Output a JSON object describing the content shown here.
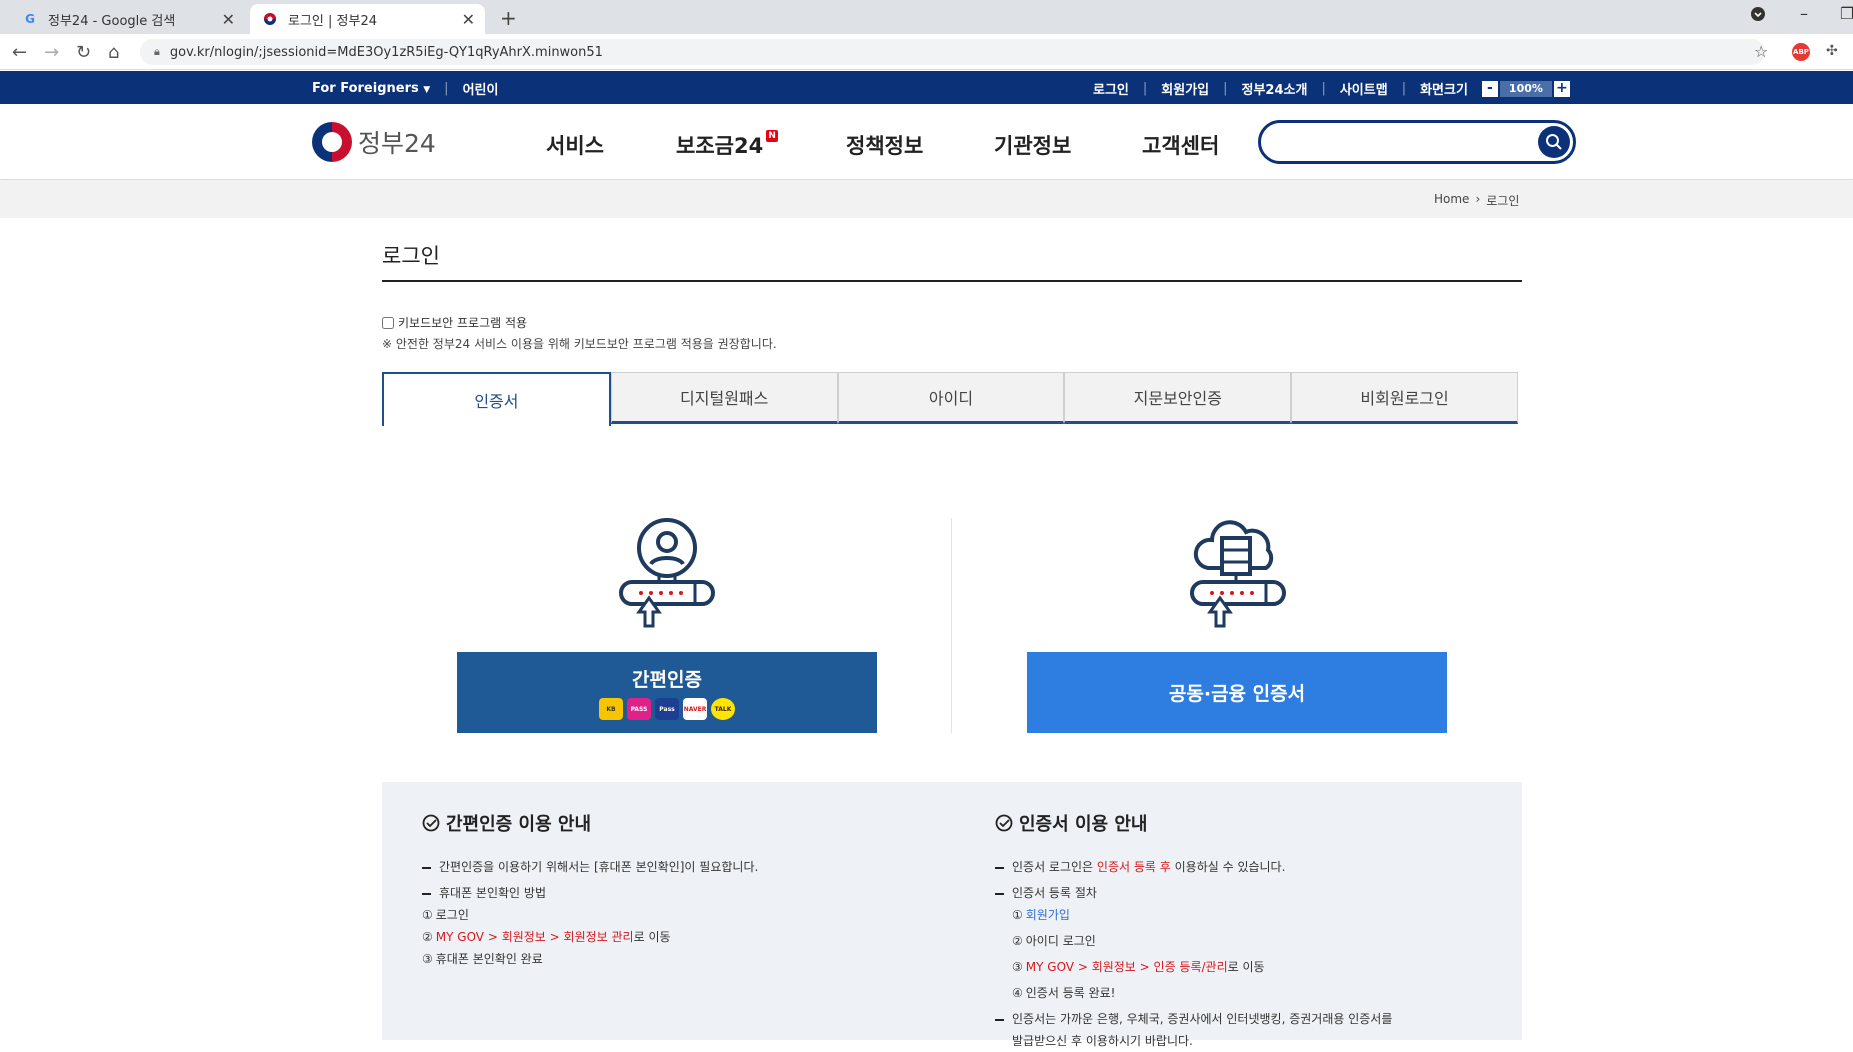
{
  "browser": {
    "tabs": [
      {
        "title": "정부24 - Google 검색",
        "active": false
      },
      {
        "title": "로그인 | 정부24",
        "active": true
      }
    ],
    "url": "gov.kr/nlogin/;jsessionid=MdE3Oy1zR5iEg-QY1qRyAhrX.minwon51"
  },
  "utilbar": {
    "left": [
      "For Foreigners",
      "어린이"
    ],
    "right": [
      "로그인",
      "회원가입",
      "정부24소개",
      "사이트맵"
    ],
    "zoom_label": "화면크기",
    "zoom_value": "100%",
    "zoom_minus": "-",
    "zoom_plus": "+"
  },
  "header": {
    "logo_text": "정부24",
    "nav": [
      "서비스",
      "보조금24",
      "정책정보",
      "기관정보",
      "고객센터"
    ],
    "new_badge": "N",
    "search_placeholder": ""
  },
  "breadcrumb": [
    "Home",
    "로그인"
  ],
  "page": {
    "title": "로그인",
    "keyboard_security_label": "키보드보안 프로그램 적용",
    "keyboard_security_note": "※ 안전한 정부24 서비스 이용을 위해 키보드보안 프로그램 적용을 권장합니다.",
    "login_tabs": [
      "인증서",
      "디지털원패스",
      "아이디",
      "지문보안인증",
      "비회원로그인"
    ],
    "active_tab": 0,
    "simple_auth_button": "간편인증",
    "simple_auth_apps": [
      "KB",
      "PASS",
      "Pass",
      "NAVER",
      "TALK"
    ],
    "cert_button": "공동·금융 인증서"
  },
  "guide": {
    "left_title": "간편인증 이용 안내",
    "left_lines": [
      "간편인증을 이용하기 위해서는 [휴대폰 본인확인]이 필요합니다.",
      "휴대폰 본인확인 방법"
    ],
    "left_steps": [
      {
        "num": "①",
        "text": "로그인"
      },
      {
        "num": "②",
        "red": "MY GOV > 회원정보 > 회원정보 관리",
        "text": "로 이동"
      },
      {
        "num": "③",
        "text": "휴대폰 본인확인 완료"
      }
    ],
    "right_title": "인증서 이용 안내",
    "right_line1_pre": "인증서 로그인은 ",
    "right_line1_red": "인증서 등록 후",
    "right_line1_post": " 이용하실 수 있습니다.",
    "right_line2": "인증서 등록 절차",
    "right_steps": [
      {
        "num": "①",
        "blue": "회원가입"
      },
      {
        "num": "②",
        "text": "아이디 로그인"
      },
      {
        "num": "③",
        "red": "MY GOV > 회원정보 > 인증 등록/관리",
        "text": "로 이동"
      },
      {
        "num": "④",
        "text": "인증서 등록 완료!"
      }
    ],
    "right_line3a": "인증서는 가까운 은행, 우체국, 증권사에서 인터넷뱅킹, 증권거래용 인증서를",
    "right_line3b": "발급받으신 후 이용하시기 바랍니다."
  },
  "colors": {
    "navy": "#0b3278",
    "tab_blue": "#1f4e8c",
    "btn_simple": "#1f5a96",
    "btn_cert": "#2e7de0",
    "red": "#d8171c"
  }
}
